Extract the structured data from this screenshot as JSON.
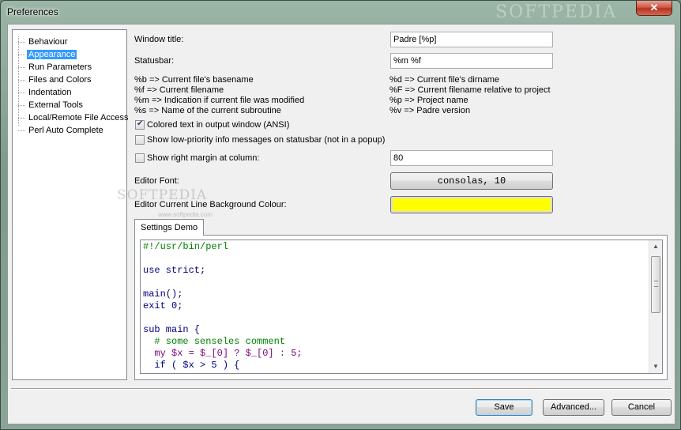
{
  "window": {
    "title": "Preferences",
    "watermark": "SOFTPEDIA",
    "close_glyph": "✕"
  },
  "tree": {
    "items": [
      {
        "label": "Behaviour",
        "selected": false
      },
      {
        "label": "Appearance",
        "selected": true
      },
      {
        "label": "Run Parameters",
        "selected": false
      },
      {
        "label": "Files and Colors",
        "selected": false
      },
      {
        "label": "Indentation",
        "selected": false
      },
      {
        "label": "External Tools",
        "selected": false
      },
      {
        "label": "Local/Remote File Access",
        "selected": false
      },
      {
        "label": "Perl Auto Complete",
        "selected": false
      }
    ]
  },
  "appearance": {
    "window_title_label": "Window title:",
    "window_title_value": "Padre [%p]",
    "statusbar_label": "Statusbar:",
    "statusbar_value": "%m %f",
    "help_left": [
      "%b => Current file's basename",
      "%f => Current filename",
      "%m => Indication if current file was modified",
      "%s => Name of the current subroutine"
    ],
    "help_right": [
      "%d => Current file's dirname",
      "%F => Current filename relative to project",
      "%p => Project name",
      "%v => Padre version"
    ],
    "colored_output_label": "Colored text in output window (ANSI)",
    "colored_output_checked": true,
    "low_priority_label": "Show low-priority info messages on statusbar (not in a popup)",
    "low_priority_checked": false,
    "right_margin_label": "Show right margin at column:",
    "right_margin_checked": false,
    "right_margin_value": "80",
    "editor_font_label": "Editor Font:",
    "editor_font_value": "consolas, 10",
    "line_bg_label": "Editor Current Line Background Colour:",
    "line_bg_color": "#ffff00",
    "watermark": "SOFTPEDIA",
    "watermark_url": "www.softpedia.com"
  },
  "demo": {
    "tab_label": "Settings Demo",
    "code": [
      {
        "text": "#!/usr/bin/perl",
        "color": "#008000"
      },
      {
        "text": "",
        "color": "#000000"
      },
      {
        "text": "use strict;",
        "color": "#00007f"
      },
      {
        "text": "",
        "color": "#000000"
      },
      {
        "text": "main();",
        "color": "#00007f"
      },
      {
        "text": "exit 0;",
        "color": "#00007f"
      },
      {
        "text": "",
        "color": "#000000"
      },
      {
        "text": "sub main {",
        "color": "#00007f"
      },
      {
        "text": "  # some senseles comment",
        "color": "#008000"
      },
      {
        "text": "  my $x = $_[0] ? $_[0] : 5;",
        "color": "#7f007f"
      },
      {
        "text": "  if ( $x > 5 ) {",
        "color": "#00007f"
      }
    ]
  },
  "buttons": {
    "save": "Save",
    "advanced": "Advanced...",
    "cancel": "Cancel"
  }
}
